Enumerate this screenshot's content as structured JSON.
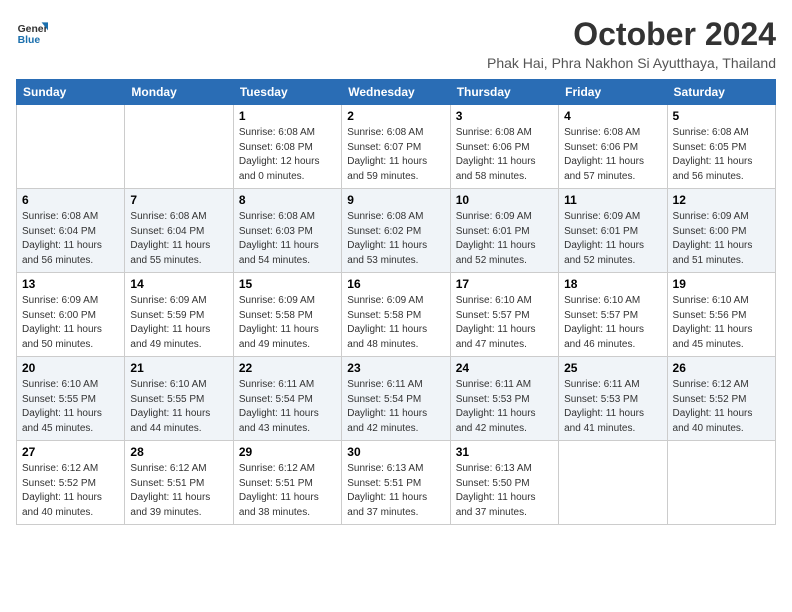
{
  "logo": {
    "line1": "General",
    "line2": "Blue"
  },
  "title": "October 2024",
  "location": "Phak Hai, Phra Nakhon Si Ayutthaya, Thailand",
  "days_of_week": [
    "Sunday",
    "Monday",
    "Tuesday",
    "Wednesday",
    "Thursday",
    "Friday",
    "Saturday"
  ],
  "weeks": [
    [
      {
        "day": "",
        "info": ""
      },
      {
        "day": "",
        "info": ""
      },
      {
        "day": "1",
        "info": "Sunrise: 6:08 AM\nSunset: 6:08 PM\nDaylight: 12 hours\nand 0 minutes."
      },
      {
        "day": "2",
        "info": "Sunrise: 6:08 AM\nSunset: 6:07 PM\nDaylight: 11 hours\nand 59 minutes."
      },
      {
        "day": "3",
        "info": "Sunrise: 6:08 AM\nSunset: 6:06 PM\nDaylight: 11 hours\nand 58 minutes."
      },
      {
        "day": "4",
        "info": "Sunrise: 6:08 AM\nSunset: 6:06 PM\nDaylight: 11 hours\nand 57 minutes."
      },
      {
        "day": "5",
        "info": "Sunrise: 6:08 AM\nSunset: 6:05 PM\nDaylight: 11 hours\nand 56 minutes."
      }
    ],
    [
      {
        "day": "6",
        "info": "Sunrise: 6:08 AM\nSunset: 6:04 PM\nDaylight: 11 hours\nand 56 minutes."
      },
      {
        "day": "7",
        "info": "Sunrise: 6:08 AM\nSunset: 6:04 PM\nDaylight: 11 hours\nand 55 minutes."
      },
      {
        "day": "8",
        "info": "Sunrise: 6:08 AM\nSunset: 6:03 PM\nDaylight: 11 hours\nand 54 minutes."
      },
      {
        "day": "9",
        "info": "Sunrise: 6:08 AM\nSunset: 6:02 PM\nDaylight: 11 hours\nand 53 minutes."
      },
      {
        "day": "10",
        "info": "Sunrise: 6:09 AM\nSunset: 6:01 PM\nDaylight: 11 hours\nand 52 minutes."
      },
      {
        "day": "11",
        "info": "Sunrise: 6:09 AM\nSunset: 6:01 PM\nDaylight: 11 hours\nand 52 minutes."
      },
      {
        "day": "12",
        "info": "Sunrise: 6:09 AM\nSunset: 6:00 PM\nDaylight: 11 hours\nand 51 minutes."
      }
    ],
    [
      {
        "day": "13",
        "info": "Sunrise: 6:09 AM\nSunset: 6:00 PM\nDaylight: 11 hours\nand 50 minutes."
      },
      {
        "day": "14",
        "info": "Sunrise: 6:09 AM\nSunset: 5:59 PM\nDaylight: 11 hours\nand 49 minutes."
      },
      {
        "day": "15",
        "info": "Sunrise: 6:09 AM\nSunset: 5:58 PM\nDaylight: 11 hours\nand 49 minutes."
      },
      {
        "day": "16",
        "info": "Sunrise: 6:09 AM\nSunset: 5:58 PM\nDaylight: 11 hours\nand 48 minutes."
      },
      {
        "day": "17",
        "info": "Sunrise: 6:10 AM\nSunset: 5:57 PM\nDaylight: 11 hours\nand 47 minutes."
      },
      {
        "day": "18",
        "info": "Sunrise: 6:10 AM\nSunset: 5:57 PM\nDaylight: 11 hours\nand 46 minutes."
      },
      {
        "day": "19",
        "info": "Sunrise: 6:10 AM\nSunset: 5:56 PM\nDaylight: 11 hours\nand 45 minutes."
      }
    ],
    [
      {
        "day": "20",
        "info": "Sunrise: 6:10 AM\nSunset: 5:55 PM\nDaylight: 11 hours\nand 45 minutes."
      },
      {
        "day": "21",
        "info": "Sunrise: 6:10 AM\nSunset: 5:55 PM\nDaylight: 11 hours\nand 44 minutes."
      },
      {
        "day": "22",
        "info": "Sunrise: 6:11 AM\nSunset: 5:54 PM\nDaylight: 11 hours\nand 43 minutes."
      },
      {
        "day": "23",
        "info": "Sunrise: 6:11 AM\nSunset: 5:54 PM\nDaylight: 11 hours\nand 42 minutes."
      },
      {
        "day": "24",
        "info": "Sunrise: 6:11 AM\nSunset: 5:53 PM\nDaylight: 11 hours\nand 42 minutes."
      },
      {
        "day": "25",
        "info": "Sunrise: 6:11 AM\nSunset: 5:53 PM\nDaylight: 11 hours\nand 41 minutes."
      },
      {
        "day": "26",
        "info": "Sunrise: 6:12 AM\nSunset: 5:52 PM\nDaylight: 11 hours\nand 40 minutes."
      }
    ],
    [
      {
        "day": "27",
        "info": "Sunrise: 6:12 AM\nSunset: 5:52 PM\nDaylight: 11 hours\nand 40 minutes."
      },
      {
        "day": "28",
        "info": "Sunrise: 6:12 AM\nSunset: 5:51 PM\nDaylight: 11 hours\nand 39 minutes."
      },
      {
        "day": "29",
        "info": "Sunrise: 6:12 AM\nSunset: 5:51 PM\nDaylight: 11 hours\nand 38 minutes."
      },
      {
        "day": "30",
        "info": "Sunrise: 6:13 AM\nSunset: 5:51 PM\nDaylight: 11 hours\nand 37 minutes."
      },
      {
        "day": "31",
        "info": "Sunrise: 6:13 AM\nSunset: 5:50 PM\nDaylight: 11 hours\nand 37 minutes."
      },
      {
        "day": "",
        "info": ""
      },
      {
        "day": "",
        "info": ""
      }
    ]
  ]
}
